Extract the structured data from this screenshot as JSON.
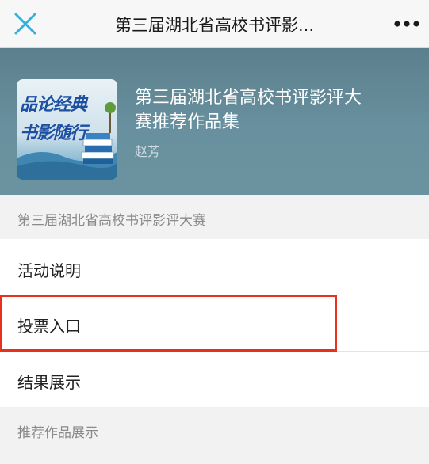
{
  "nav": {
    "title": "第三届湖北省高校书评影...",
    "close_icon": "close-icon",
    "more_icon": "more-icon"
  },
  "header": {
    "cover_line1": "品论经典",
    "cover_line2": "书影随行",
    "title": "第三届湖北省高校书评影评大赛推荐作品集",
    "author": "赵芳"
  },
  "section1": {
    "label": "第三届湖北省高校书评影评大赛"
  },
  "menu": {
    "activity": "活动说明",
    "vote": "投票入口",
    "results": "结果展示"
  },
  "section2": {
    "label": "推荐作品展示"
  },
  "colors": {
    "accent": "#2fb2e0",
    "highlight": "#e8311a",
    "header_bg": "#628a98"
  }
}
